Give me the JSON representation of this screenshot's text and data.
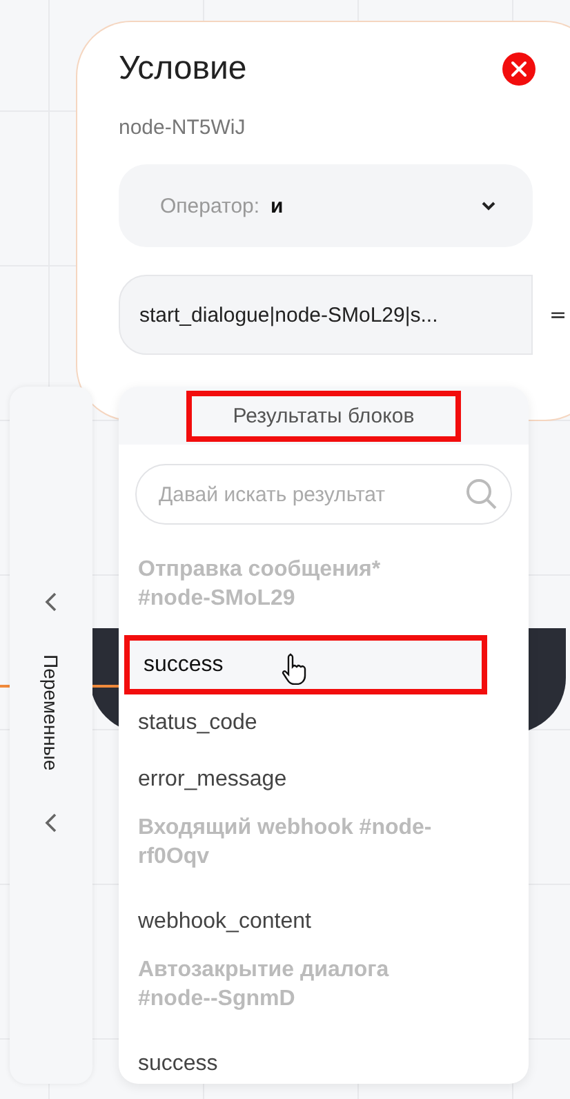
{
  "card": {
    "title": "Условие",
    "node_id": "node-NT5WiJ",
    "operator": {
      "label": "Оператор:",
      "value": "и"
    },
    "condition": {
      "value": "start_dialogue|node-SMoL29|s...",
      "operator": "="
    }
  },
  "sidebar": {
    "label": "Переменные"
  },
  "dropdown": {
    "header": "Результаты блоков",
    "header_highlighted": true,
    "search": {
      "placeholder": "Давай искать результат"
    },
    "items": [
      {
        "kind": "group",
        "label": "Отправка сообщения* #node-SMoL29"
      },
      {
        "kind": "option",
        "label": "success",
        "selected": true,
        "highlighted": true
      },
      {
        "kind": "option",
        "label": "status_code",
        "selected": false,
        "highlighted": false
      },
      {
        "kind": "option",
        "label": "error_message",
        "selected": false,
        "highlighted": false
      },
      {
        "kind": "group",
        "label": "Входящий webhook #node-rf0Oqv"
      },
      {
        "kind": "option",
        "label": "webhook_content",
        "selected": false,
        "highlighted": false
      },
      {
        "kind": "group",
        "label": "Автозакрытие диалога #node--SgnmD"
      },
      {
        "kind": "option",
        "label": "success",
        "selected": false,
        "highlighted": false
      }
    ]
  }
}
